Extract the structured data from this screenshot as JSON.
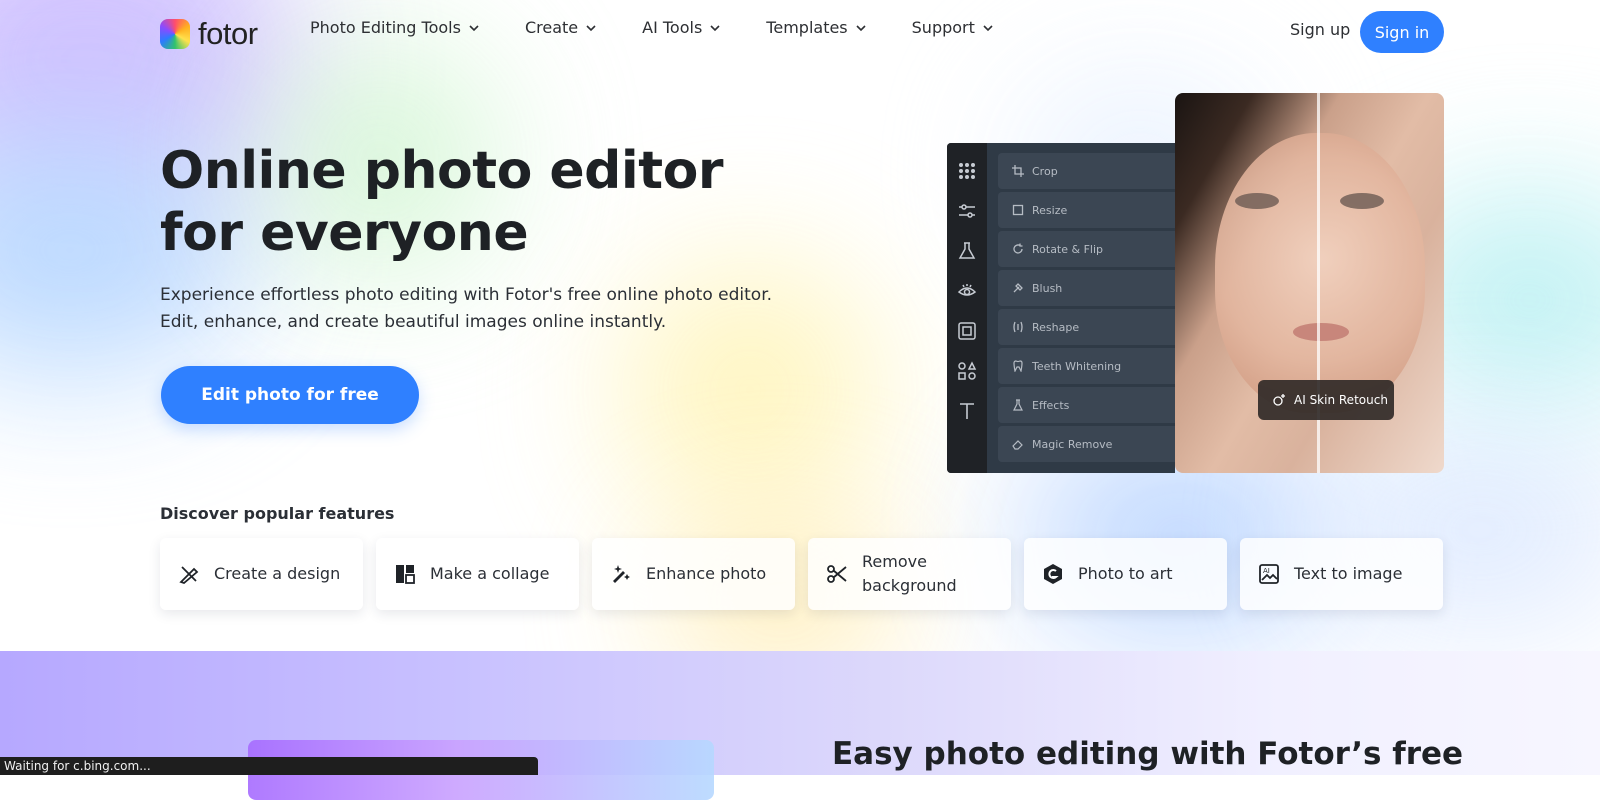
{
  "header": {
    "brand": "fotor",
    "nav": [
      {
        "label": "Photo Editing Tools"
      },
      {
        "label": "Create"
      },
      {
        "label": "AI Tools"
      },
      {
        "label": "Templates"
      },
      {
        "label": "Support"
      }
    ],
    "sign_up": "Sign up",
    "sign_in": "Sign in"
  },
  "hero": {
    "title": "Online photo editor for everyone",
    "subtitle_line1": "Experience effortless photo editing with Fotor's free online photo editor.",
    "subtitle_line2": "Edit, enhance, and create beautiful images online instantly.",
    "cta": "Edit photo for free"
  },
  "editor": {
    "tools": [
      {
        "label": "Crop"
      },
      {
        "label": "Resize"
      },
      {
        "label": "Rotate & Flip"
      },
      {
        "label": "Blush"
      },
      {
        "label": "Reshape"
      },
      {
        "label": "Teeth Whitening"
      },
      {
        "label": "Effects"
      },
      {
        "label": "Magic Remove"
      }
    ],
    "badge": "AI Skin Retouch"
  },
  "features": {
    "title": "Discover popular features",
    "items": [
      {
        "label": "Create a design"
      },
      {
        "label": "Make a collage"
      },
      {
        "label": "Enhance photo"
      },
      {
        "label": "Remove background"
      },
      {
        "label": "Photo to art"
      },
      {
        "label": "Text to image"
      }
    ]
  },
  "lower": {
    "title": "Easy photo editing with Fotor’s free"
  },
  "status_bar": {
    "text": "Waiting for c.bing.com..."
  },
  "colors": {
    "accent": "#2f80ff",
    "text": "#1e2125"
  }
}
